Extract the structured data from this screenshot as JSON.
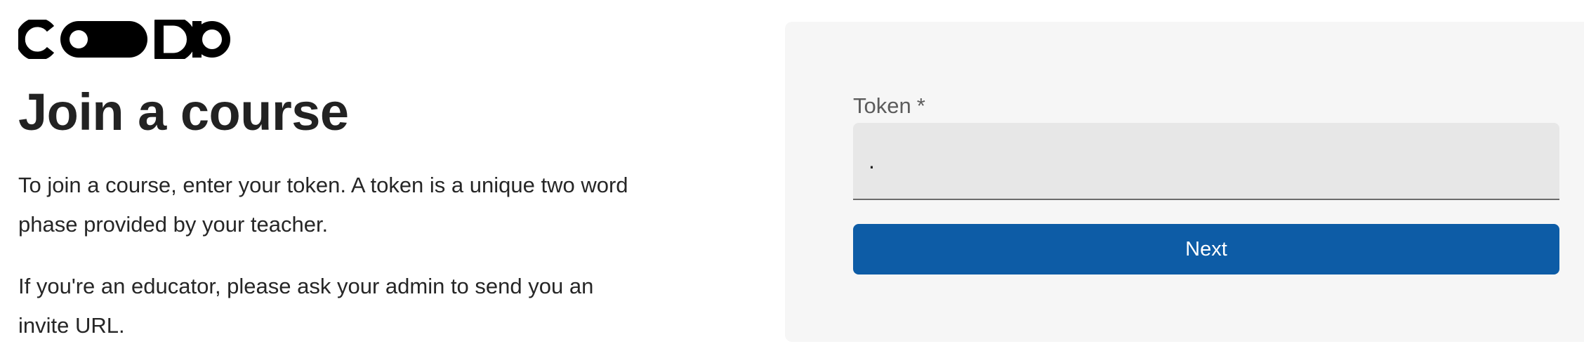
{
  "brand": {
    "logo_text": "CODIO"
  },
  "main": {
    "title": "Join a course",
    "paragraph_1": "To join a course, enter your token. A token is a unique two word phase provided by your teacher.",
    "paragraph_2": "If you're an educator, please ask your admin to send you an invite URL."
  },
  "form": {
    "token_label": "Token",
    "token_required_marker": "*",
    "token_value": ".",
    "next_label": "Next"
  },
  "colors": {
    "primary_button": "#0d5ca6",
    "panel_background": "#f6f6f6",
    "input_background": "#e7e7e7",
    "logo": "#000000"
  }
}
